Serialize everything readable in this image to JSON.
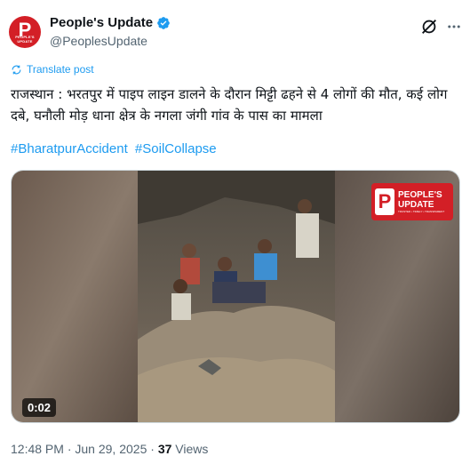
{
  "author": {
    "name": "People's Update",
    "handle": "@PeoplesUpdate",
    "avatar_letter": "P",
    "avatar_tagline": "PEOPLE'S UPDATE",
    "verified": true
  },
  "icons": {
    "verified": "verified-badge-icon",
    "grok": "grok-icon",
    "more": "more-icon",
    "translate": "translate-icon"
  },
  "translate_label": "Translate post",
  "post_text": "राजस्थान : भरतपुर में पाइप लाइन डालने के दौरान मिट्टी ढहने से 4 लोगों की मौत, कई लोग दबे, घनौली मोड़ धाना क्षेत्र के नगला जंगी गांव के पास का मामला",
  "hashtags": [
    "#BharatpurAccident",
    "#SoilCollapse"
  ],
  "media": {
    "duration": "0:02",
    "watermark_letter": "P",
    "watermark_line1": "PEOPLE'S",
    "watermark_line2": "UPDATE",
    "watermark_small": "TRUSTED • TIMELY • TRANSPARENT"
  },
  "meta": {
    "time": "12:48 PM",
    "separator": "·",
    "date": "Jun 29, 2025",
    "views_count": "37",
    "views_label": "Views"
  },
  "colors": {
    "accent": "#1d9bf0",
    "brand_red": "#d31f26",
    "text": "#0f1419",
    "muted": "#536471"
  }
}
